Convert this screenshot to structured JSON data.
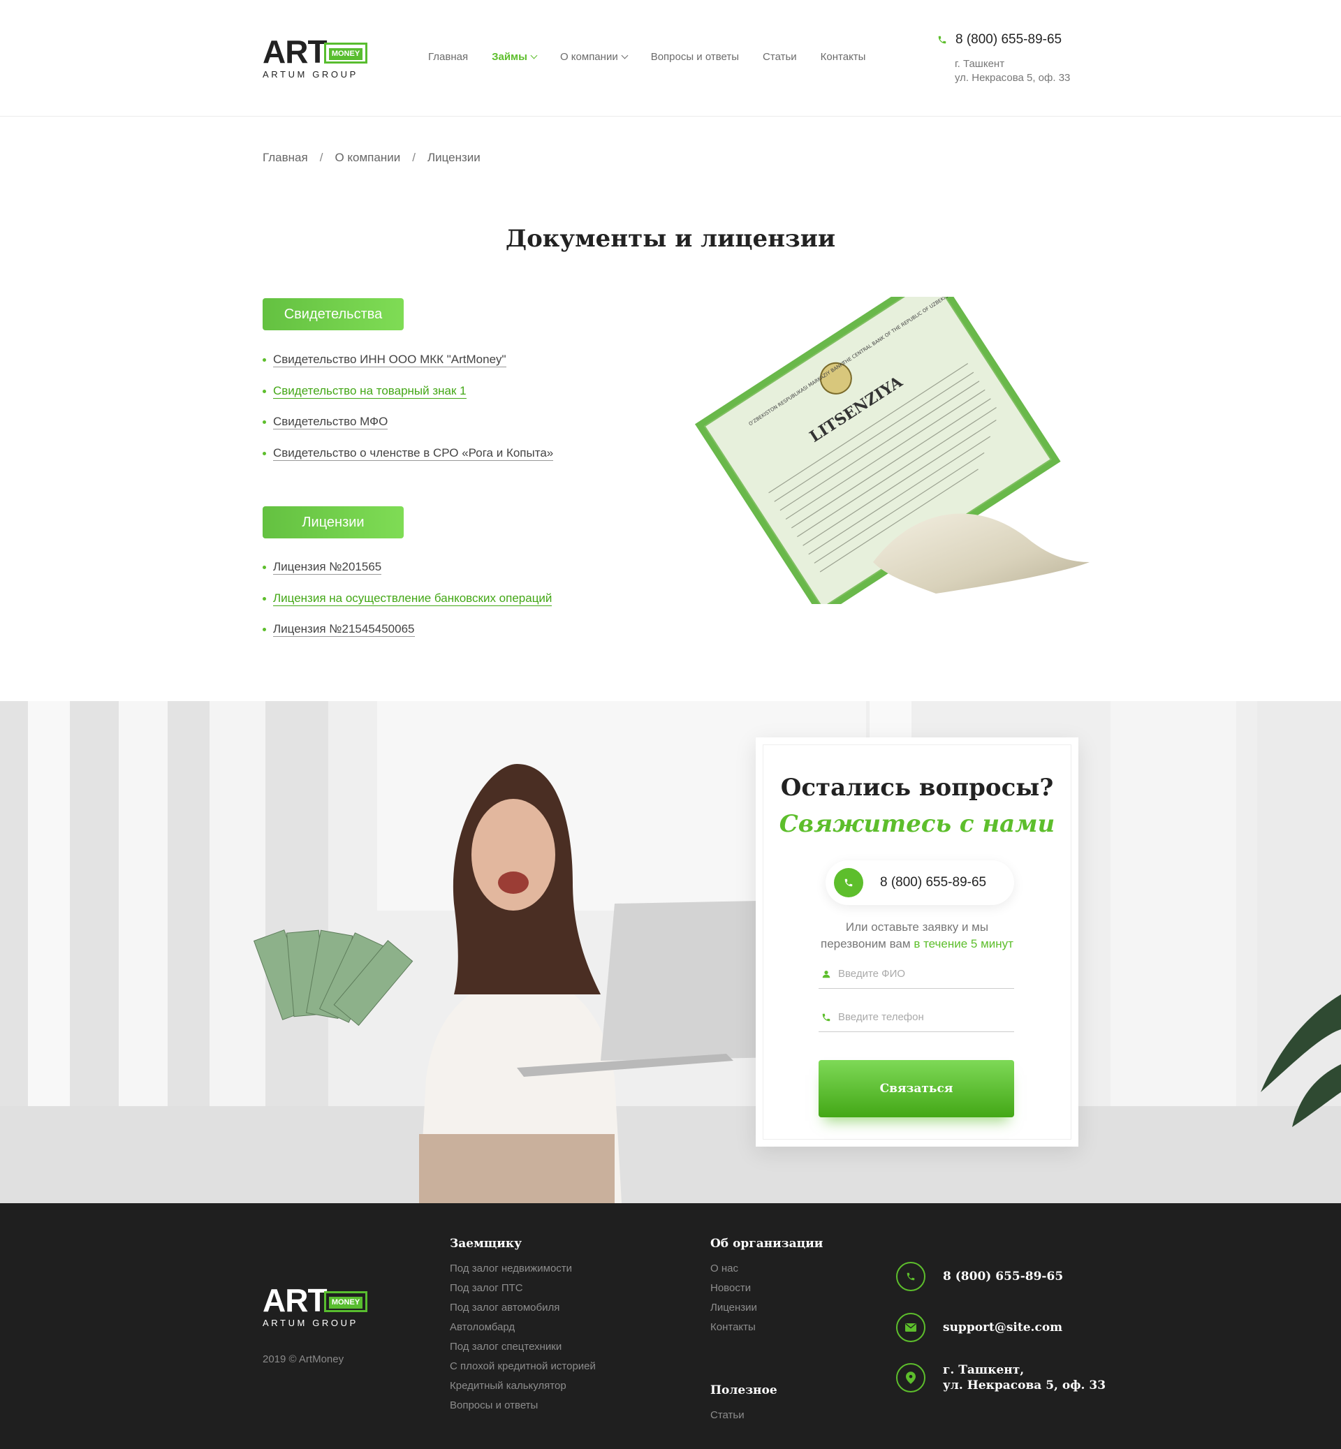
{
  "header": {
    "logo_main": "ART",
    "logo_badge": "MONEY",
    "logo_sub": "ARTUM GROUP",
    "nav": [
      {
        "label": "Главная"
      },
      {
        "label": "Займы"
      },
      {
        "label": "О компании"
      },
      {
        "label": "Вопросы и ответы"
      },
      {
        "label": "Статьи"
      },
      {
        "label": "Контакты"
      }
    ],
    "phone": "8 (800) 655-89-65",
    "city": "г. Ташкент",
    "address": "ул. Некрасова 5, оф. 33"
  },
  "breadcrumb": [
    "Главная",
    "О компании",
    "Лицензии"
  ],
  "page_title": "Документы и лицензии",
  "certificates": {
    "label": "Свидетельства",
    "items": [
      "Свидетельство ИНН ООО МКК \"ArtMoney\"",
      "Свидетельство на товарный знак 1",
      "Свидетельство МФО",
      "Свидетельство о членстве в СРО «Рога и Копыта»"
    ]
  },
  "licenses": {
    "label": "Лицензии",
    "items": [
      "Лицензия №201565",
      "Лицензия на осуществление банковских операций",
      "Лицензия №21545450065"
    ]
  },
  "cert_image": {
    "title": "LITSENZIYA",
    "header_left": "O'ZBEKISTON RESPUBLIKASI MARKAZIY BANKI",
    "header_right": "THE CENTRAL BANK OF THE REPUBLIC OF UZBEKISTAN"
  },
  "contact": {
    "question": "Остались вопросы?",
    "cta": "Свяжитесь с нами",
    "phone": "8 (800) 655-89-65",
    "hint_1": "Или оставьте заявку и мы",
    "hint_2": "перезвоним вам",
    "hint_highlight": "в течение 5 минут",
    "name_placeholder": "Введите ФИО",
    "phone_placeholder": "Введите телефон",
    "submit_label": "Связаться"
  },
  "footer": {
    "copyright": "2019 © ArtMoney",
    "col1_title": "Заемщику",
    "col1_items": [
      "Под залог недвижимости",
      "Под залог ПТС",
      "Под залог автомобиля",
      "Автоломбард",
      "Под залог спецтехники",
      "С плохой кредитной историей",
      "Кредитный калькулятор",
      "Вопросы и ответы"
    ],
    "col2_title": "Об организации",
    "col2_items": [
      "О нас",
      "Новости",
      "Лицензии",
      "Контакты"
    ],
    "col3_title": "Полезное",
    "col3_items": [
      "Статьи"
    ],
    "phone": "8 (800) 655-89-65",
    "email": "support@site.com",
    "address_1": "г. Ташкент,",
    "address_2": "ул. Некрасова 5, оф. 33"
  },
  "colors": {
    "accent": "#5dbe2c",
    "footer_bg": "#1f1f1f"
  },
  "icons": [
    "phone-icon",
    "chevron-down-icon",
    "user-icon",
    "mail-icon",
    "location-pin-icon"
  ]
}
